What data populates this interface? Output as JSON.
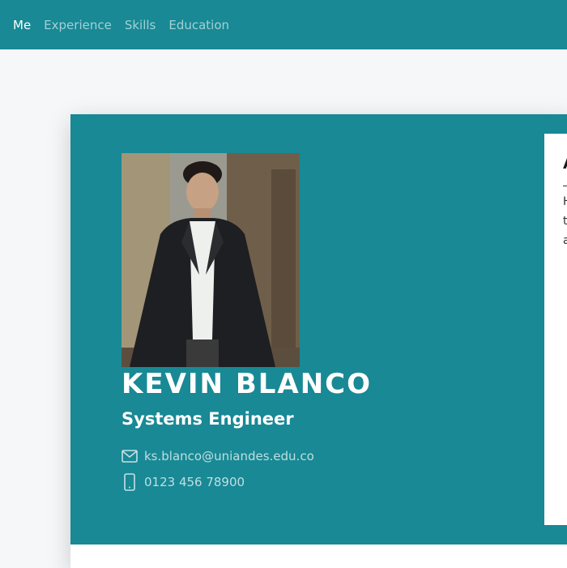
{
  "nav": {
    "items": [
      {
        "label": "Me",
        "active": true
      },
      {
        "label": "Experience",
        "active": false
      },
      {
        "label": "Skills",
        "active": false
      },
      {
        "label": "Education",
        "active": false
      }
    ]
  },
  "profile": {
    "name": "KEVIN BLANCO",
    "title": "Systems Engineer",
    "email": "ks.blanco@uniandes.edu.co",
    "phone": "0123 456 78900",
    "photo_alt": "Profile photo"
  },
  "about": {
    "title_visible": "A",
    "lines": [
      "H",
      "t",
      "a"
    ]
  },
  "icons": {
    "email": "envelope-icon",
    "phone": "mobile-phone-icon"
  },
  "colors": {
    "primary": "#188995",
    "background": "#f6f7f9",
    "text_light": "#ffffff"
  }
}
